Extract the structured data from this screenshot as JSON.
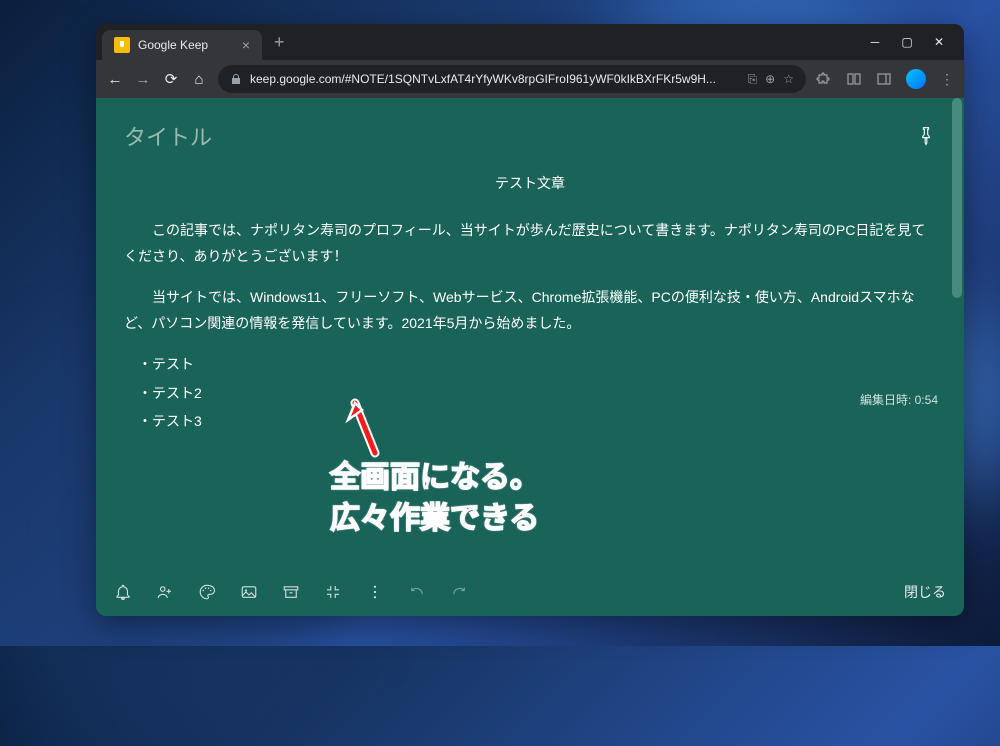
{
  "browser": {
    "tab_title": "Google Keep",
    "url_display": "keep.google.com/#NOTE/1SQNTvLxfAT4rYfyWKv8rpGIFroI961yWF0kIkBXrFKr5w9H..."
  },
  "note": {
    "title": "タイトル",
    "heading": "テスト文章",
    "para1": "この記事では、ナポリタン寿司のプロフィール、当サイトが歩んだ歴史について書きます。ナポリタン寿司のPC日記を見てくださり、ありがとうございます！",
    "para2": "当サイトでは、Windows11、フリーソフト、Webサービス、Chrome拡張機能、PCの便利な技・使い方、Androidスマホなど、パソコン関連の情報を発信しています。2021年5月から始めました。",
    "list": [
      "・テスト",
      "・テスト2",
      "・テスト3"
    ],
    "edited_label": "編集日時: 0:54",
    "close_label": "閉じる"
  },
  "annotation": {
    "line1": "全画面になる。",
    "line2": "広々作業できる"
  },
  "icons": {
    "reminder": "reminder-icon",
    "collaborator": "collaborator-icon",
    "palette": "palette-icon",
    "image": "image-icon",
    "archive": "archive-icon",
    "more": "more-icon",
    "undo": "undo-icon",
    "redo": "redo-icon"
  }
}
